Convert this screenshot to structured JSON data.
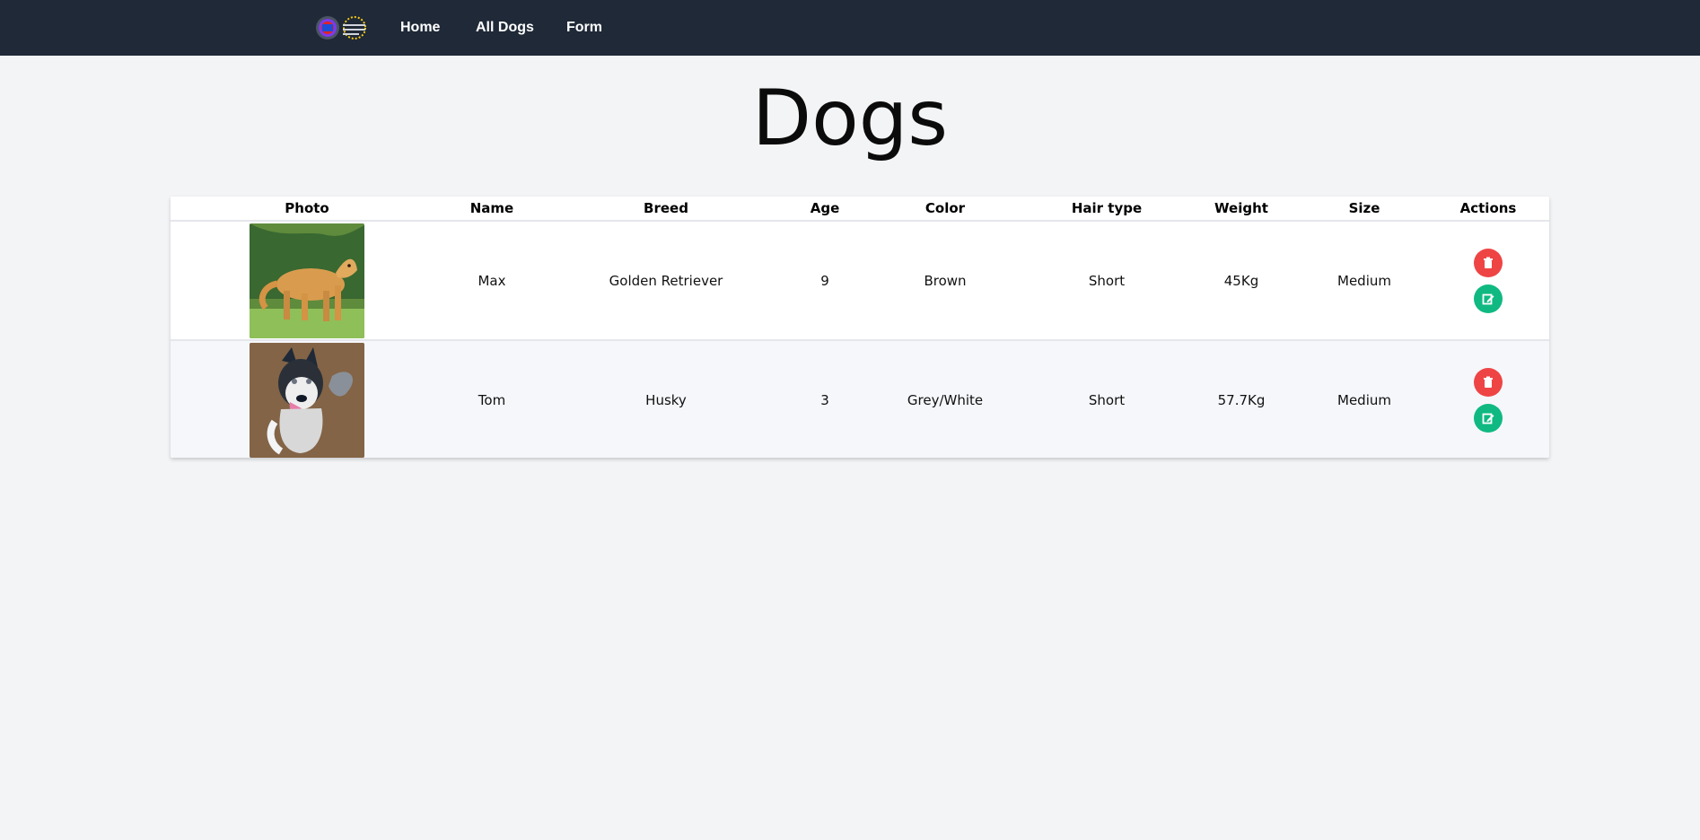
{
  "nav": {
    "links": [
      {
        "label": "Home"
      },
      {
        "label": "All Dogs"
      },
      {
        "label": "Form"
      }
    ]
  },
  "page": {
    "title": "Dogs"
  },
  "table": {
    "headers": [
      "Photo",
      "Name",
      "Breed",
      "Age",
      "Color",
      "Hair type",
      "Weight",
      "Size",
      "Actions"
    ],
    "rows": [
      {
        "photo": "golden-retriever-photo",
        "name": "Max",
        "breed": "Golden Retriever",
        "age": "9",
        "color": "Brown",
        "hair_type": "Short",
        "weight": "45Kg",
        "size": "Medium"
      },
      {
        "photo": "husky-photo",
        "name": "Tom",
        "breed": "Husky",
        "age": "3",
        "color": "Grey/White",
        "hair_type": "Short",
        "weight": "57.7Kg",
        "size": "Medium"
      }
    ]
  },
  "icons": {
    "delete": "trash-icon",
    "edit": "edit-icon"
  },
  "colors": {
    "navbar": "#1f2937",
    "delete": "#ef4444",
    "edit": "#10b981",
    "background": "#f3f4f6"
  }
}
